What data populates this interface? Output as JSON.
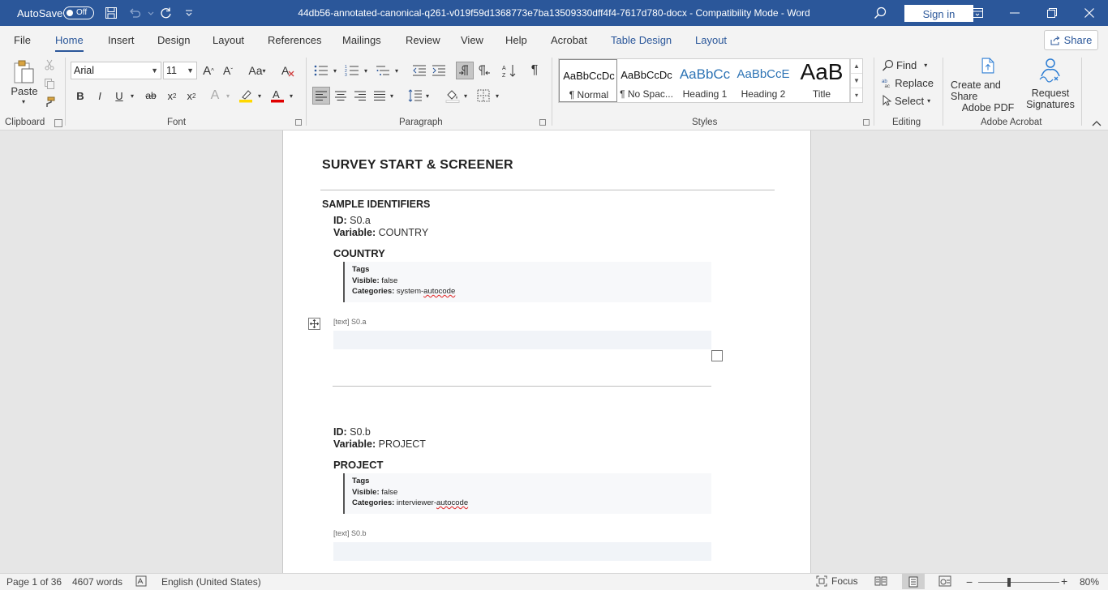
{
  "titlebar": {
    "autosave_label": "AutoSave",
    "autosave_state": "Off",
    "document_title": "44db56-annotated-canonical-q261-v019f59d1368773e7ba13509330dff4f4-7617d780-docx  -  Compatibility Mode  -  Word",
    "signin_label": "Sign in"
  },
  "tabs": {
    "file": "File",
    "home": "Home",
    "insert": "Insert",
    "design": "Design",
    "layout": "Layout",
    "references": "References",
    "mailings": "Mailings",
    "review": "Review",
    "view": "View",
    "help": "Help",
    "acrobat": "Acrobat",
    "table_design": "Table Design",
    "table_layout": "Layout",
    "share_label": "Share",
    "accent_color": "#2b579a"
  },
  "ribbon": {
    "clipboard": {
      "paste_label": "Paste",
      "group_label": "Clipboard"
    },
    "font": {
      "font_name": "Arial",
      "font_size": "11",
      "group_label": "Font",
      "grow": "A",
      "shrink": "A",
      "case": "Aa",
      "bold": "B",
      "italic": "I",
      "underline": "U",
      "strike": "ab",
      "subscript": "x",
      "superscript": "x",
      "effects": "A",
      "highlight_color": "#ffd800",
      "font_color": "#e00000"
    },
    "paragraph": {
      "group_label": "Paragraph"
    },
    "styles": {
      "group_label": "Styles",
      "items": [
        {
          "sample": "AaBbCcDc",
          "name": "¶ Normal"
        },
        {
          "sample": "AaBbCcDc",
          "name": "¶ No Spac..."
        },
        {
          "sample": "AaBbCc",
          "name": "Heading 1"
        },
        {
          "sample": "AaBbCcE",
          "name": "Heading 2"
        },
        {
          "sample": "AaB",
          "name": "Title"
        }
      ]
    },
    "editing": {
      "group_label": "Editing",
      "find": "Find",
      "replace": "Replace",
      "select": "Select"
    },
    "acrobat": {
      "group_label": "Adobe Acrobat",
      "create_share_line1": "Create and Share",
      "create_share_line2": "Adobe PDF",
      "request_line1": "Request",
      "request_line2": "Signatures"
    }
  },
  "document": {
    "heading": "SURVEY START & SCREENER",
    "section": "SAMPLE IDENTIFIERS",
    "id_label": "ID:",
    "variable_label": "Variable:",
    "tags_label": "Tags",
    "visible_label": "Visible:",
    "categories_label": "Categories:",
    "questions": [
      {
        "id": "S0.a",
        "variable": "COUNTRY",
        "title": "COUNTRY",
        "visible": "false",
        "categories_prefix": "system-",
        "categories_flagged": "autocode",
        "text_label": "[text] S0.a"
      },
      {
        "id": "S0.b",
        "variable": "PROJECT",
        "title": "PROJECT",
        "visible": "false",
        "categories_prefix": "interviewer-",
        "categories_flagged": "autocode",
        "text_label": "[text] S0.b"
      }
    ]
  },
  "statusbar": {
    "page": "Page 1 of 36",
    "words": "4607 words",
    "language": "English (United States)",
    "focus": "Focus",
    "zoom": "80%"
  }
}
